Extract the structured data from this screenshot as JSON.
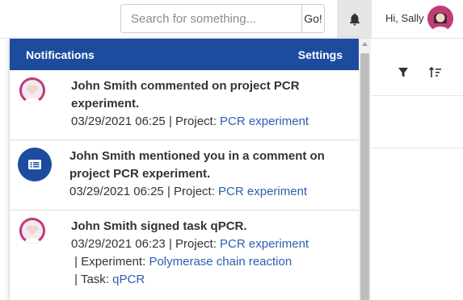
{
  "search": {
    "placeholder": "Search for something...",
    "go_label": "Go!"
  },
  "header": {
    "greeting": "Hi, Sally",
    "bell_icon": "bell-icon"
  },
  "background": {
    "filter_icon": "filter-icon",
    "sort_icon": "sort-icon"
  },
  "notifications": {
    "title": "Notifications",
    "settings_label": "Settings",
    "items": [
      {
        "avatar": "user-avatar",
        "title": "John Smith commented on project PCR experiment.",
        "datetime": "03/29/2021 06:25",
        "sep1": " | Project: ",
        "project": "PCR experiment"
      },
      {
        "avatar": "comment-icon",
        "title": "John Smith mentioned you in a comment on project PCR experiment.",
        "datetime": "03/29/2021 06:25",
        "sep1": " | Project: ",
        "project": "PCR experiment"
      },
      {
        "avatar": "user-avatar",
        "title": "John Smith signed task qPCR.",
        "datetime": "03/29/2021 06:23",
        "sep1": " | Project: ",
        "project": "PCR experiment",
        "sep2": " | Experiment: ",
        "experiment": "Polymerase chain reaction",
        "sep3": " | Task: ",
        "task": "qPCR"
      }
    ]
  },
  "colors": {
    "header_bg": "#1d4c9f",
    "link": "#2b5fb0",
    "avatar_bg": "#c13b7a",
    "bell_bg": "#e6e6e6"
  }
}
